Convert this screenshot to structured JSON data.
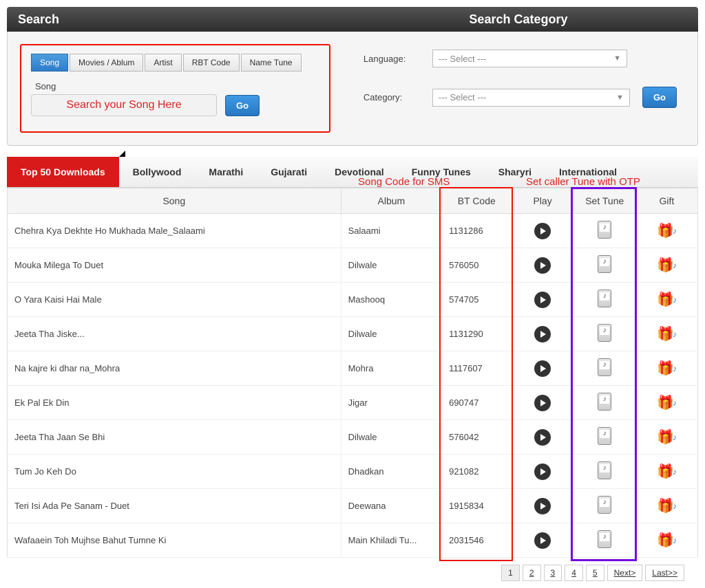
{
  "header": {
    "search": "Search",
    "searchCategory": "Search Category"
  },
  "searchTabs": [
    "Song",
    "Movies / Ablum",
    "Artist",
    "RBT Code",
    "Name Tune"
  ],
  "searchLabel": "Song",
  "searchPlaceholder": "Search your Song Here",
  "go": "Go",
  "category": {
    "languageLabel": "Language:",
    "categoryLabel": "Category:",
    "placeholder": "--- Select ---"
  },
  "mainTabs": [
    "Top 50 Downloads",
    "Bollywood",
    "Marathi",
    "Gujarati",
    "Devotional",
    "Funny Tunes",
    "Sharyri",
    "International"
  ],
  "annotations": {
    "smsCode": "Song Code for SMS",
    "otp": "Set caller Tune with OTP"
  },
  "columns": {
    "song": "Song",
    "album": "Album",
    "bt": "BT Code",
    "play": "Play",
    "set": "Set Tune",
    "gift": "Gift"
  },
  "rows": [
    {
      "song": "Chehra Kya Dekhte Ho Mukhada Male_Salaami",
      "album": "Salaami",
      "bt": "1131286"
    },
    {
      "song": "Mouka Milega To Duet",
      "album": "Dilwale",
      "bt": "576050"
    },
    {
      "song": "O Yara Kaisi Hai Male",
      "album": "Mashooq",
      "bt": "574705"
    },
    {
      "song": "Jeeta Tha Jiske...",
      "album": "Dilwale",
      "bt": "1131290"
    },
    {
      "song": "Na kajre ki dhar na_Mohra",
      "album": "Mohra",
      "bt": "1117607"
    },
    {
      "song": "Ek Pal Ek Din",
      "album": "Jigar",
      "bt": "690747"
    },
    {
      "song": "Jeeta Tha Jaan Se Bhi",
      "album": "Dilwale",
      "bt": "576042"
    },
    {
      "song": "Tum Jo Keh Do",
      "album": "Dhadkan",
      "bt": "921082"
    },
    {
      "song": "Teri Isi Ada Pe Sanam - Duet",
      "album": "Deewana",
      "bt": "1915834"
    },
    {
      "song": "Wafaaein Toh Mujhse Bahut Tumne Ki",
      "album": "Main Khiladi Tu...",
      "bt": "2031546"
    }
  ],
  "pagination": {
    "pages": [
      "1",
      "2",
      "3",
      "4",
      "5"
    ],
    "next": "Next>",
    "last": "Last>>"
  }
}
